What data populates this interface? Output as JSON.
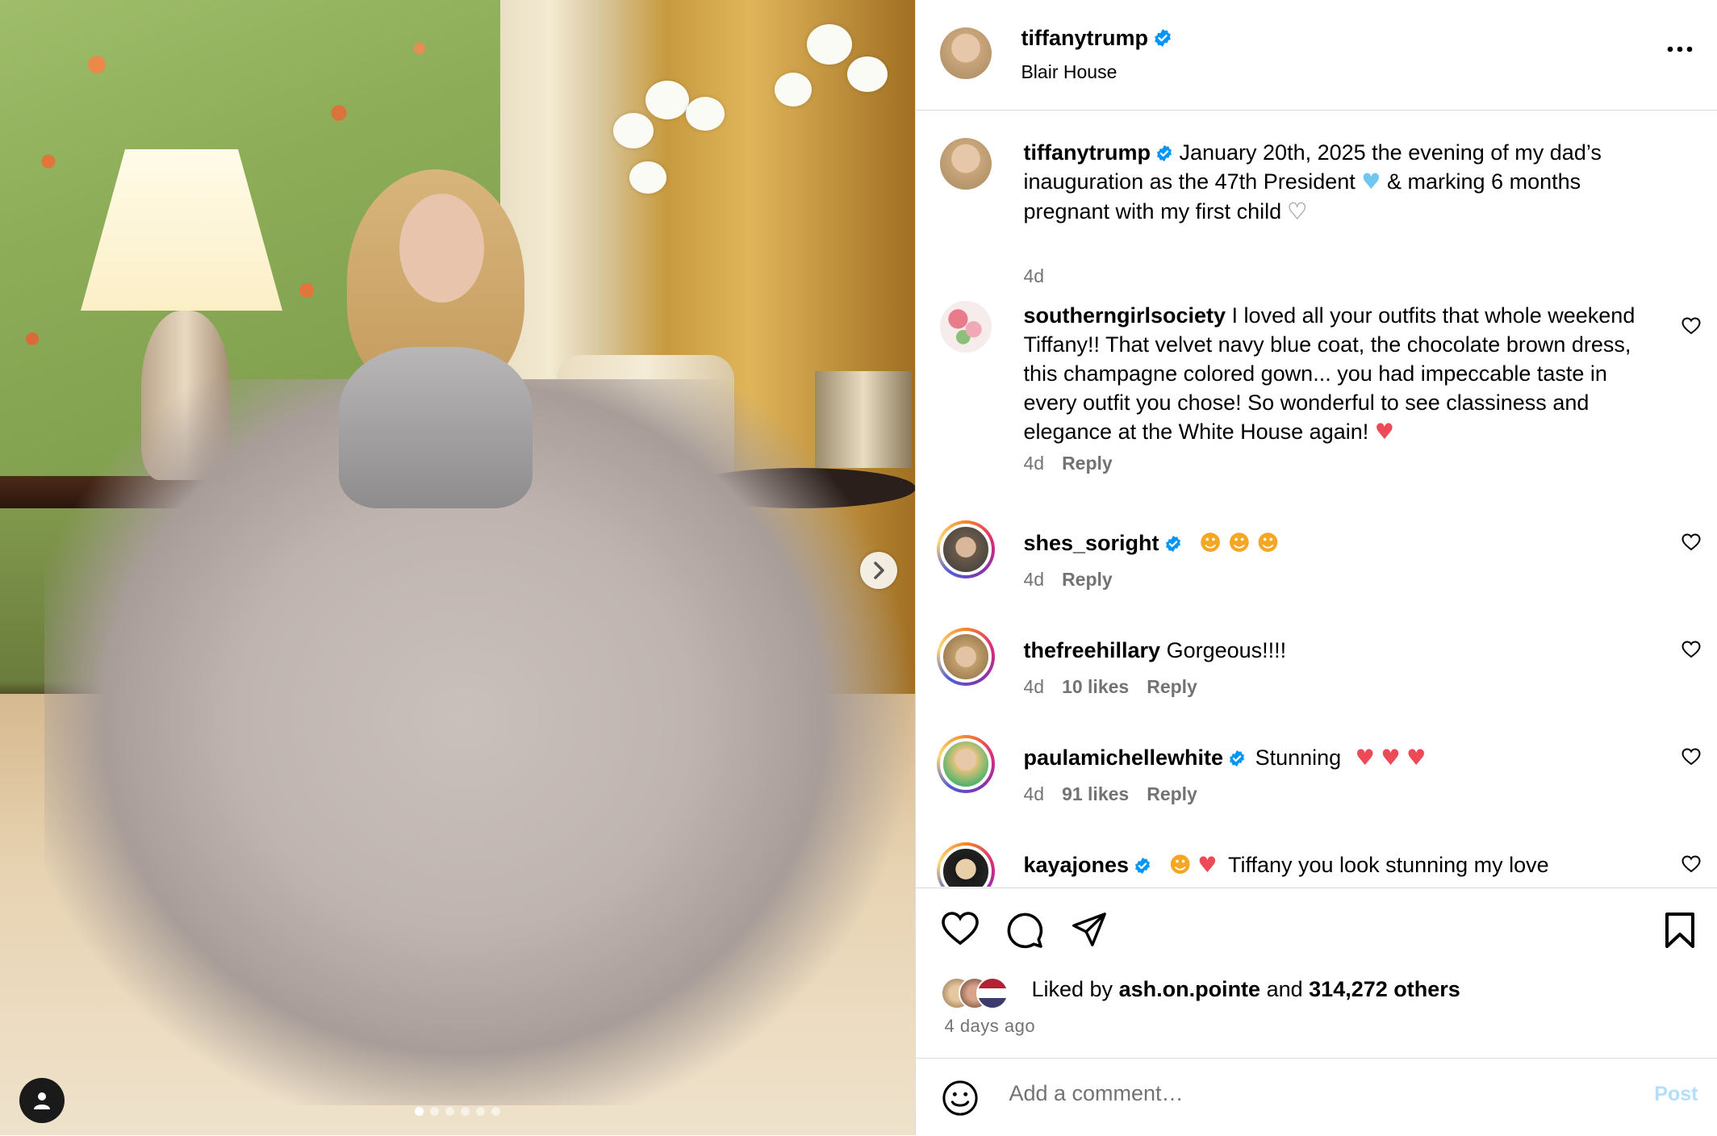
{
  "media": {
    "slide_count": 6,
    "active_slide": 1
  },
  "header": {
    "username": "tiffanytrump",
    "location": "Blair House"
  },
  "caption": {
    "username": "tiffanytrump",
    "text_1": "January 20th, 2025 the evening of my dad’s inauguration as the 47th President",
    "text_2": "& marking 6 months pregnant with my first child",
    "age": "4d"
  },
  "comments": [
    {
      "username": "southerngirlsociety",
      "text": "I loved all your outfits that whole weekend Tiffany!! That velvet navy blue coat, the chocolate brown dress, this champagne colored gown... you had impeccable taste in every outfit you chose! So wonderful to see classiness and elegance at the White House again!",
      "age": "4d",
      "likes": "",
      "reply": "Reply"
    },
    {
      "username": "shes_soright",
      "text": "",
      "age": "4d",
      "likes": "",
      "reply": "Reply"
    },
    {
      "username": "thefreehillary",
      "text": "Gorgeous!!!!",
      "age": "4d",
      "likes": "10 likes",
      "reply": "Reply"
    },
    {
      "username": "paulamichellewhite",
      "text": "Stunning",
      "age": "4d",
      "likes": "91 likes",
      "reply": "Reply"
    },
    {
      "username": "kayajones",
      "text": "Tiffany you look stunning my love",
      "age": "",
      "likes": "",
      "reply": ""
    }
  ],
  "likes": {
    "prefix": "Liked by",
    "user": "ash.on.pointe",
    "conj": "and",
    "count": "314,272 others"
  },
  "posted": "4 days ago",
  "composer": {
    "placeholder": "Add a comment…",
    "post_label": "Post"
  },
  "colors": {
    "verified": "#0095f6",
    "heart_red": "#ed4956",
    "post_disabled": "#b2dffc"
  }
}
